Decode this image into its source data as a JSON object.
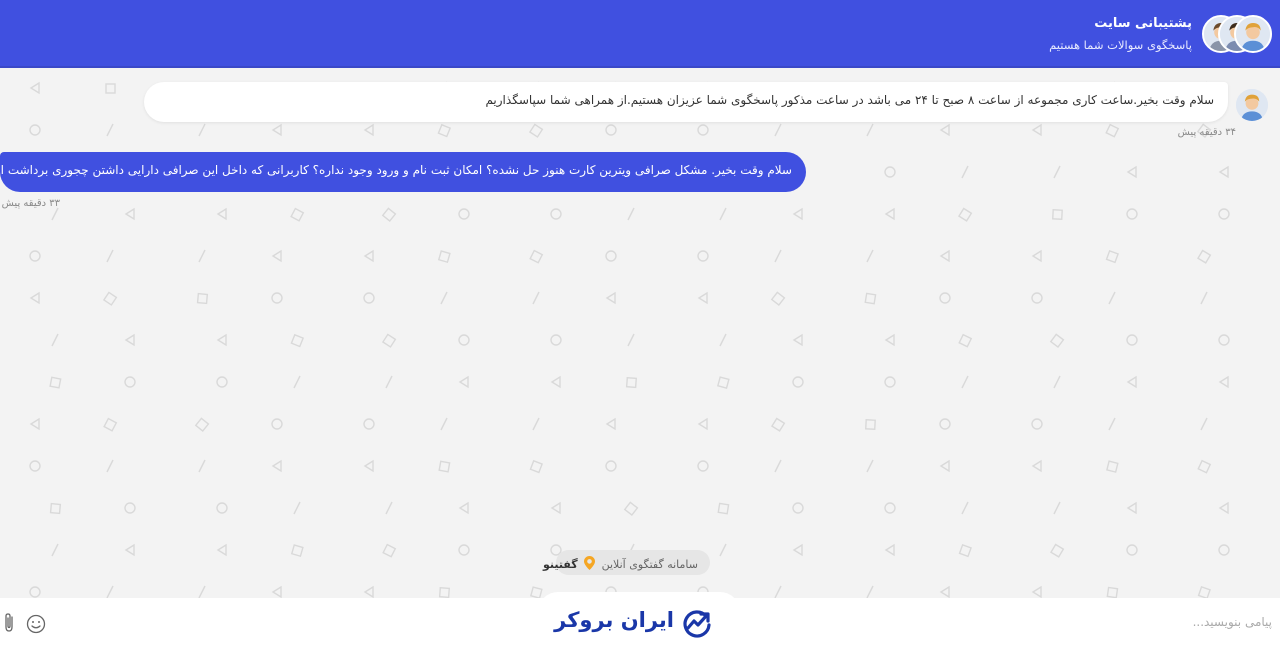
{
  "header": {
    "title": "پشتیبانی سایت",
    "subtitle": "پاسخگوی سوالات شما هستیم",
    "bg_color": "#4050e0"
  },
  "messages": [
    {
      "sender": "agent",
      "text": "سلام وقت بخیر.ساعت کاری مجموعه از ساعت ۸ صبح تا ۲۴ می باشد در ساعت مذکور پاسخگوی شما عزیزان هستیم.از همراهی شما سپاسگذاریم",
      "time": "۳۴ دقیقه پیش"
    },
    {
      "sender": "user",
      "text": "سلام وقت بخیر. مشکل صرافی ویترین کارت هنوز حل نشده؟ امکان ثبت نام  و ورود وجود نداره؟ کاربرانی که داخل این صرافی دارایی داشتن چجوری برداشت انجام بدن؟",
      "time": "۳۳ دقیقه پیش"
    }
  ],
  "branding": {
    "label": "سامانه گفتگوی آنلاین",
    "name": "گفتینو",
    "pin_color": "#f5a623"
  },
  "composer": {
    "placeholder": "پیامی بنویسید...",
    "value": ""
  },
  "logo": {
    "text": "ایران بروکر",
    "color": "#1a37a8"
  },
  "colors": {
    "accent": "#4050e0",
    "background": "#f3f3f3"
  }
}
